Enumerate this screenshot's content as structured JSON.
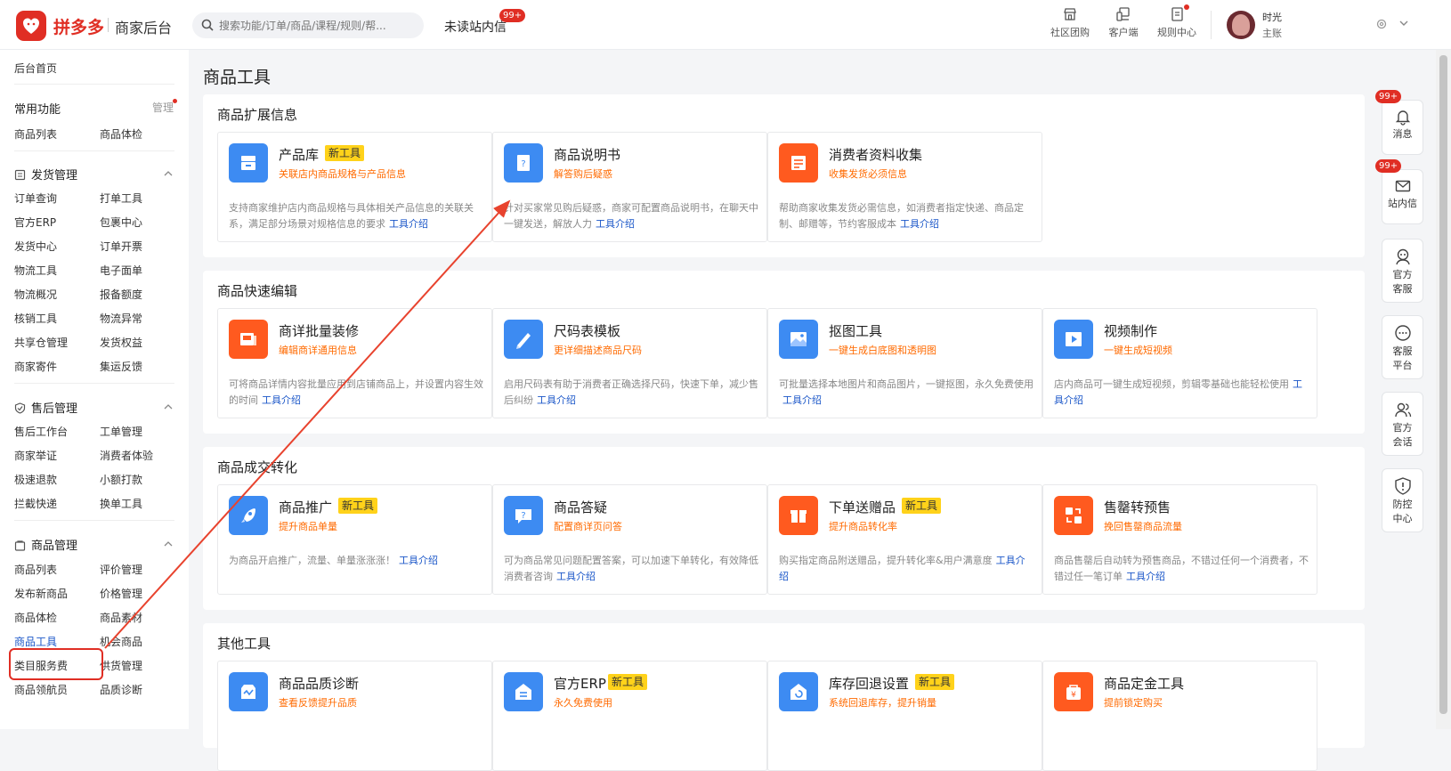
{
  "header": {
    "brand": "拼多多",
    "brand_sub": "商家后台",
    "search_placeholder": "搜索功能/订单/商品/课程/规则/帮...",
    "unread": "未读站内信",
    "unread_badge": "99+",
    "links": [
      {
        "label": "社区团购",
        "icon": "store-icon"
      },
      {
        "label": "客户端",
        "icon": "devices-icon"
      },
      {
        "label": "规则中心",
        "icon": "document-icon"
      }
    ],
    "user_line1": "时光",
    "user_line2": "主账"
  },
  "sidebar": {
    "home": "后台首页",
    "common_title": "常用功能",
    "manage": "管理",
    "common_items": [
      "商品列表",
      "商品体检"
    ],
    "sections": [
      {
        "title": "发货管理",
        "icon": "shipping-list-icon",
        "items": [
          "订单查询",
          "打单工具",
          "官方ERP",
          "包裹中心",
          "发货中心",
          "订单开票",
          "物流工具",
          "电子面单",
          "物流概况",
          "报备额度",
          "核销工具",
          "物流异常",
          "共享仓管理",
          "发货权益",
          "商家寄件",
          "集运反馈"
        ]
      },
      {
        "title": "售后管理",
        "icon": "shield-check-icon",
        "items": [
          "售后工作台",
          "工单管理",
          "商家举证",
          "消费者体验",
          "极速退款",
          "小额打款",
          "拦截快递",
          "换单工具"
        ]
      },
      {
        "title": "商品管理",
        "icon": "bag-icon",
        "items": [
          "商品列表",
          "评价管理",
          "发布新商品",
          "价格管理",
          "商品体检",
          "商品素材",
          "商品工具",
          "机会商品",
          "类目服务费",
          "供货管理",
          "商品领航员",
          "品质诊断"
        ]
      }
    ],
    "active_item": "商品工具"
  },
  "main": {
    "title": "商品工具",
    "link_label": "工具介绍",
    "sections": [
      {
        "title": "商品扩展信息",
        "cards": [
          {
            "name": "产品库",
            "tag": "新工具",
            "sub": "关联店内商品规格与产品信息",
            "desc": "支持商家维护店内商品规格与具体相关产品信息的关联关系，满足部分场景对规格信息的要求",
            "color": "blue",
            "icon": "archive-icon"
          },
          {
            "name": "商品说明书",
            "tag": "",
            "sub": "解答购后疑惑",
            "desc": "针对买家常见购后疑惑，商家可配置商品说明书，在聊天中一键发送，解放人力",
            "color": "blue",
            "icon": "manual-book-icon"
          },
          {
            "name": "消费者资料收集",
            "tag": "",
            "sub": "收集发货必须信息",
            "desc": "帮助商家收集发货必需信息，如消费者指定快递、商品定制、邮赠等，节约客服成本",
            "color": "orange",
            "icon": "form-icon"
          }
        ]
      },
      {
        "title": "商品快速编辑",
        "cards": [
          {
            "name": "商详批量装修",
            "tag": "",
            "sub": "编辑商详通用信息",
            "desc": "可将商品详情内容批量应用到店铺商品上，并设置内容生效的时间",
            "color": "orange",
            "icon": "layout-icon"
          },
          {
            "name": "尺码表模板",
            "tag": "",
            "sub": "更详细描述商品尺码",
            "desc": "启用尺码表有助于消费者正确选择尺码，快速下单，减少售后纠纷",
            "color": "blue",
            "icon": "ruler-pencil-icon"
          },
          {
            "name": "抠图工具",
            "tag": "",
            "sub": "一键生成白底图和透明图",
            "desc": "可批量选择本地图片和商品图片，一键抠图，永久免费使用",
            "color": "blue",
            "icon": "image-icon"
          },
          {
            "name": "视频制作",
            "tag": "",
            "sub": "一键生成短视频",
            "desc": "店内商品可一键生成短视频，剪辑零基础也能轻松使用",
            "color": "blue",
            "icon": "video-icon"
          }
        ]
      },
      {
        "title": "商品成交转化",
        "cards": [
          {
            "name": "商品推广",
            "tag": "新工具",
            "sub": "提升商品单量",
            "desc": "为商品开启推广，流量、单量涨涨涨！",
            "color": "blue",
            "icon": "rocket-icon"
          },
          {
            "name": "商品答疑",
            "tag": "",
            "sub": "配置商详页问答",
            "desc": "可为商品常见问题配置答案，可以加速下单转化，有效降低消费者咨询",
            "color": "blue",
            "icon": "question-chat-icon"
          },
          {
            "name": "下单送赠品",
            "tag": "新工具",
            "sub": "提升商品转化率",
            "desc": "购买指定商品附送赠品，提升转化率&用户满意度",
            "color": "orange",
            "icon": "gift-icon"
          },
          {
            "name": "售罄转预售",
            "tag": "",
            "sub": "挽回售罄商品流量",
            "desc": "商品售罄后自动转为预售商品，不错过任何一个消费者，不错过任一笔订单",
            "color": "orange",
            "icon": "swap-icon"
          }
        ]
      },
      {
        "title": "其他工具",
        "cards": [
          {
            "name": "商品品质诊断",
            "tag": "",
            "sub": "查看反馈提升品质",
            "desc": "",
            "color": "blue",
            "icon": "quality-chart-icon"
          },
          {
            "name": "官方ERP",
            "tag": "新工具",
            "sub": "永久免费使用",
            "desc": "",
            "color": "blue",
            "icon": "erp-house-icon"
          },
          {
            "name": "库存回退设置",
            "tag": "新工具",
            "sub": "系统回退库存，提升销量",
            "desc": "",
            "color": "blue",
            "icon": "stock-return-icon"
          },
          {
            "name": "商品定金工具",
            "tag": "",
            "sub": "提前锁定购买",
            "desc": "",
            "color": "orange",
            "icon": "deposit-bag-icon"
          }
        ]
      }
    ]
  },
  "right_panel": [
    {
      "label": "消息",
      "badge": "99+",
      "icon": "bell-icon"
    },
    {
      "label": "站内信",
      "badge": "99+",
      "icon": "mail-icon"
    },
    {
      "label": "官方客服",
      "badge": "",
      "icon": "service-avatar-icon"
    },
    {
      "label": "客服平台",
      "badge": "",
      "icon": "chat-bubble-icon"
    },
    {
      "label": "官方会话",
      "badge": "",
      "icon": "users-icon"
    },
    {
      "label": "防控中心",
      "badge": "",
      "icon": "shield-alert-icon"
    }
  ],
  "colors": {
    "brand": "#e02e24",
    "link": "#1a56c8",
    "sub_text": "#ff6a00",
    "tag": "#ffd21a",
    "icon_blue": "#3d8bf2",
    "icon_orange": "#ff5a1f",
    "annotation": "#e8432e"
  }
}
